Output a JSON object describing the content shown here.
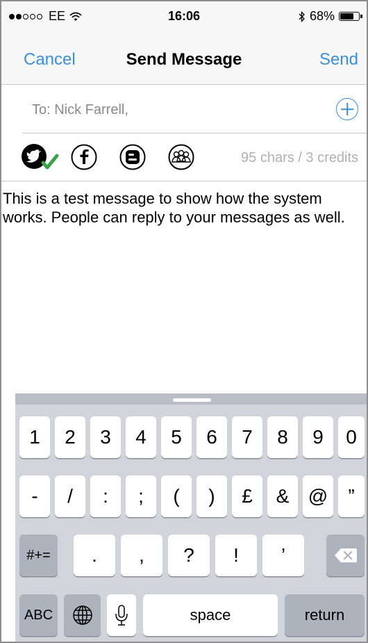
{
  "status_bar": {
    "carrier": "EE",
    "time": "16:06",
    "battery": "68%",
    "battery_level": 0.68,
    "icons": [
      "signal-dots-icon",
      "wifi-icon",
      "bluetooth-icon",
      "battery-icon"
    ]
  },
  "nav": {
    "cancel": "Cancel",
    "title": "Send Message",
    "send": "Send",
    "accent_color": "#3b8fd8"
  },
  "recipient": {
    "text": "To: Nick Farrell,",
    "add_icon": "plus-circle-icon"
  },
  "social": {
    "icons": [
      "twitter-icon",
      "facebook-icon",
      "blogger-icon",
      "group-icon"
    ],
    "twitter_selected": true,
    "counter": "95 chars / 3 credits"
  },
  "message": {
    "text": "This is a test message to show how the system works. People can reply to your messages as well."
  },
  "keyboard": {
    "row1": [
      "1",
      "2",
      "3",
      "4",
      "5",
      "6",
      "7",
      "8",
      "9",
      "0"
    ],
    "row2": [
      "-",
      "/",
      ":",
      ";",
      "(",
      ")",
      "£",
      "&",
      "@",
      "”"
    ],
    "row3": [
      "#+=",
      ".",
      ",",
      "?",
      "!",
      "’"
    ],
    "row4": [
      "ABC",
      "space",
      "return"
    ],
    "icons": [
      "globe-icon",
      "microphone-icon",
      "backspace-icon"
    ]
  }
}
